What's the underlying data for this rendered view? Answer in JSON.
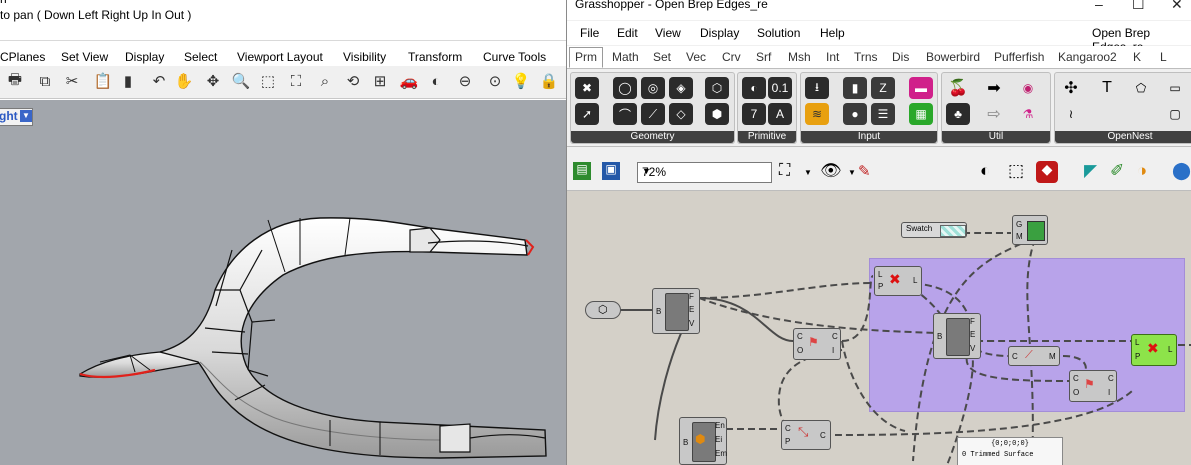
{
  "rhino": {
    "command_line": [
      "n",
      "to pan ( Down  Left  Right  Up  In  Out )"
    ],
    "tabs": [
      "CPlanes",
      "Set View",
      "Display",
      "Select",
      "Viewport Layout",
      "Visibility",
      "Transform",
      "Curve Tools"
    ],
    "viewport_label": "ght",
    "toolbar_icons": [
      "print-icon",
      "copy-icon",
      "cut-icon",
      "clipboard-icon",
      "undo-icon",
      "pan-hand-icon",
      "rotate-icon",
      "zoom-icon",
      "zoom-window-icon",
      "zoom-extents-icon",
      "zoom-selected-icon",
      "rotate-view-icon",
      "four-view-icon",
      "car-icon",
      "shaded-icon",
      "ghosted-icon",
      "render-icon",
      "light-icon",
      "lock-icon"
    ]
  },
  "grasshopper": {
    "title": "Grasshopper - Open Brep Edges_re",
    "window_buttons": {
      "minimize": "–",
      "maximize": "☐",
      "close": "✕"
    },
    "menu": [
      "File",
      "Edit",
      "View",
      "Display",
      "Solution",
      "Help"
    ],
    "document_name": "Open Brep Edges_re",
    "tabs": [
      "Prm",
      "Math",
      "Set",
      "Vec",
      "Crv",
      "Srf",
      "Msh",
      "Int",
      "Trns",
      "Dis",
      "Bowerbird",
      "Pufferfish",
      "Kangaroo2",
      "K",
      "L"
    ],
    "active_tab": "Prm",
    "ribbon_groups": [
      "Geometry",
      "Primitive",
      "Input",
      "Util",
      "OpenNest"
    ],
    "zoom": "72%",
    "canvas": {
      "swatch_label": "Swatch",
      "preview_inputs": [
        "G",
        "M"
      ],
      "brep_edges_inputs": [
        "B"
      ],
      "brep_edges_outputs": [
        "F",
        "E",
        "V"
      ],
      "cull_inputs": [
        "L",
        "P"
      ],
      "cull_outputs": [
        "L"
      ],
      "explode_inputs": [
        "C",
        "O"
      ],
      "explode_outputs": [
        "C",
        "I"
      ],
      "curve_inputs": [
        "C"
      ],
      "curve_outputs": [
        "M"
      ],
      "deconstruct_inputs": [
        "B"
      ],
      "deconstruct_outputs": [
        "En",
        "Ei",
        "Em"
      ],
      "join_inputs": [
        "C",
        "P"
      ],
      "join_outputs": [
        "C"
      ],
      "panel_header": "{0;0;0;0}",
      "panel_text": "0 Trimmed Surface"
    }
  },
  "colors": {
    "viewport_bg": "#a2a6ac",
    "gh_canvas": "#d4d0c8",
    "group_fill": "#b49cf0",
    "highlight_green": "#8de34a",
    "selected_edge": "#e0211b"
  }
}
